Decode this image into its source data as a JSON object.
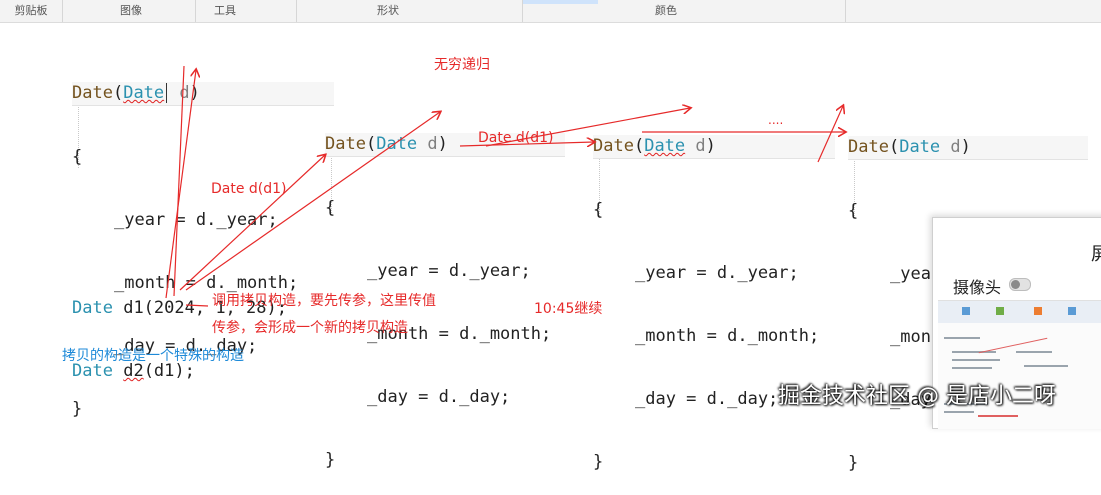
{
  "ribbon": {
    "groups": [
      "剪贴板",
      "图像",
      "工具",
      "形状",
      "颜色"
    ]
  },
  "code_blocks": [
    {
      "ctor": "Date",
      "param_type": "Date",
      "param": "d",
      "open": "{",
      "close": "}",
      "lines": [
        "_year = d._year;",
        "_month = d._month;",
        "_day = d._day;"
      ]
    },
    {
      "ctor": "Date",
      "param_type": "Date",
      "param": "d",
      "open": "{",
      "close": "}",
      "lines": [
        "_year = d._year;",
        "_month = d._month;",
        "_day = d._day;"
      ]
    },
    {
      "ctor": "Date",
      "param_type": "Date",
      "param": "d",
      "open": "{",
      "close": "}",
      "lines": [
        "_year = d._year;",
        "_month = d._month;",
        "_day = d._day;"
      ]
    },
    {
      "ctor": "Date",
      "param_type": "Date",
      "param": "d",
      "open": "{",
      "close": "}",
      "lines": [
        "_year = d._year;",
        "_month = d._month;",
        "_day = d._day;"
      ]
    }
  ],
  "main_code": {
    "line1_type": "Date",
    "line1_rest": "d1(2024, 1, 28);",
    "line2_type": "Date",
    "line2_var": "d2",
    "line2_rest": "(d1);"
  },
  "annotations": {
    "infinite_recursion": "无穷递归",
    "call1": "Date d(d1)",
    "call2": "Date d(d1)",
    "dots": "....",
    "explain_line1": "调用拷贝构造，要先传参，这里传值",
    "explain_line2": "传参，会形成一个新的拷贝构造",
    "time": "10:45继续",
    "summary": "拷贝的构造是一个特殊的构造"
  },
  "panel": {
    "title_partial": "屏",
    "camera_label": "摄像头"
  },
  "watermark": "掘金技术社区 @ 是店小二呀",
  "colors": {
    "keyword": "#2b91af",
    "function": "#74531f",
    "annotation_red": "#e62a2a",
    "annotation_blue": "#1e8ad8"
  }
}
